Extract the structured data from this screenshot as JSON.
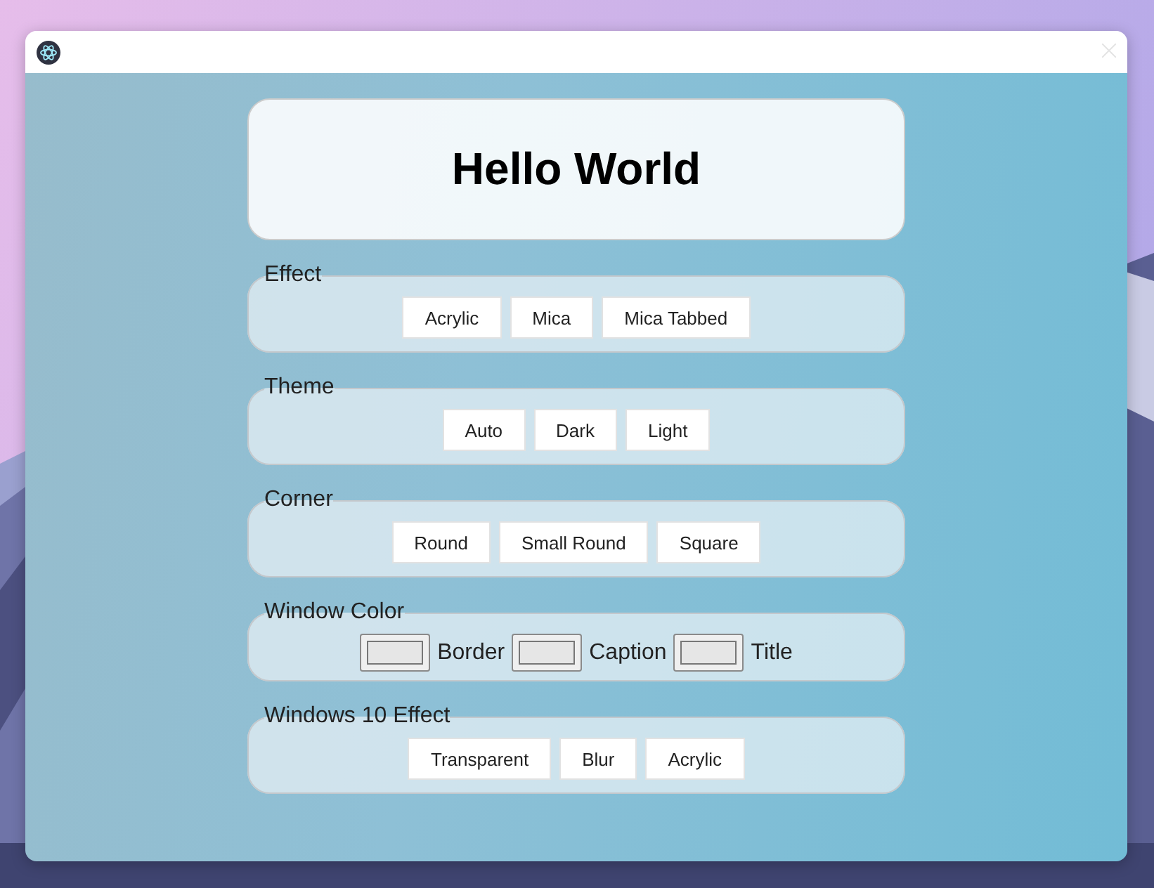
{
  "window": {
    "title_bar": {
      "closable": true
    }
  },
  "heading": "Hello World",
  "groups": [
    {
      "legend": "Effect",
      "kind": "buttons",
      "items": [
        "Acrylic",
        "Mica",
        "Mica Tabbed"
      ]
    },
    {
      "legend": "Theme",
      "kind": "buttons",
      "items": [
        "Auto",
        "Dark",
        "Light"
      ]
    },
    {
      "legend": "Corner",
      "kind": "buttons",
      "items": [
        "Round",
        "Small Round",
        "Square"
      ]
    },
    {
      "legend": "Window Color",
      "kind": "colors",
      "items": [
        "Border",
        "Caption",
        "Title"
      ]
    },
    {
      "legend": "Windows 10 Effect",
      "kind": "buttons",
      "items": [
        "Transparent",
        "Blur",
        "Acrylic"
      ]
    }
  ]
}
